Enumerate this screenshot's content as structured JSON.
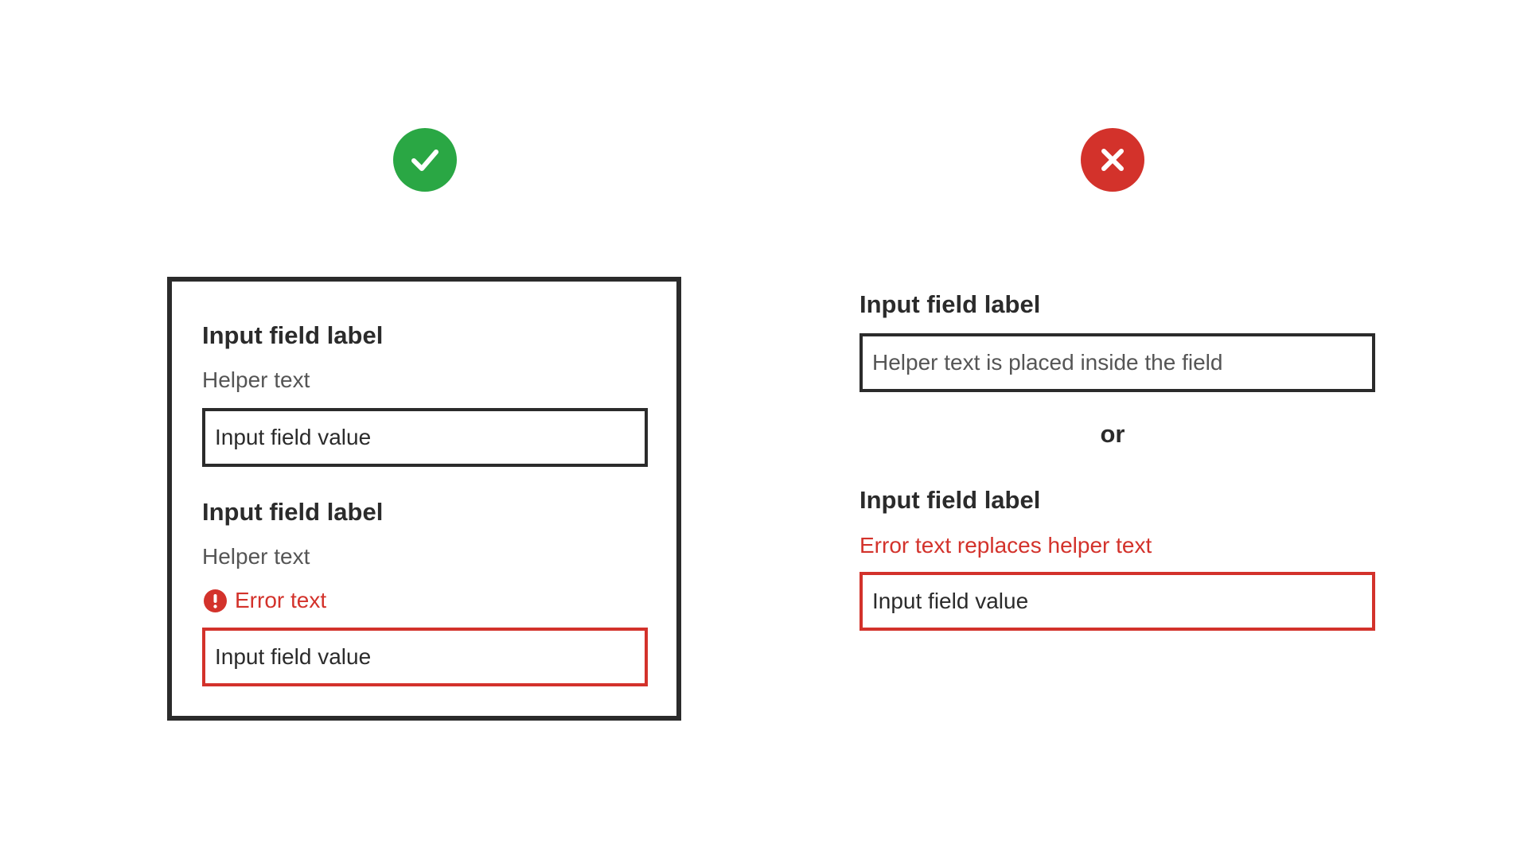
{
  "icons": {
    "correct": "checkmark-circle-icon",
    "incorrect": "x-circle-icon",
    "error": "exclamation-circle-icon"
  },
  "colors": {
    "success": "#2aa744",
    "danger": "#d3322b",
    "border": "#2b2b2b",
    "helper_text": "#555555"
  },
  "correct_example": {
    "field_1": {
      "label": "Input field label",
      "helper": "Helper text",
      "value": "Input field value"
    },
    "field_2": {
      "label": "Input field label",
      "helper": "Helper text",
      "error": "Error text",
      "value": "Input field value"
    }
  },
  "incorrect_example": {
    "field_1": {
      "label": "Input field label",
      "placeholder": "Helper text is placed inside the field"
    },
    "separator": "or",
    "field_2": {
      "label": "Input field label",
      "error": "Error text replaces helper text",
      "value": "Input field value"
    }
  }
}
